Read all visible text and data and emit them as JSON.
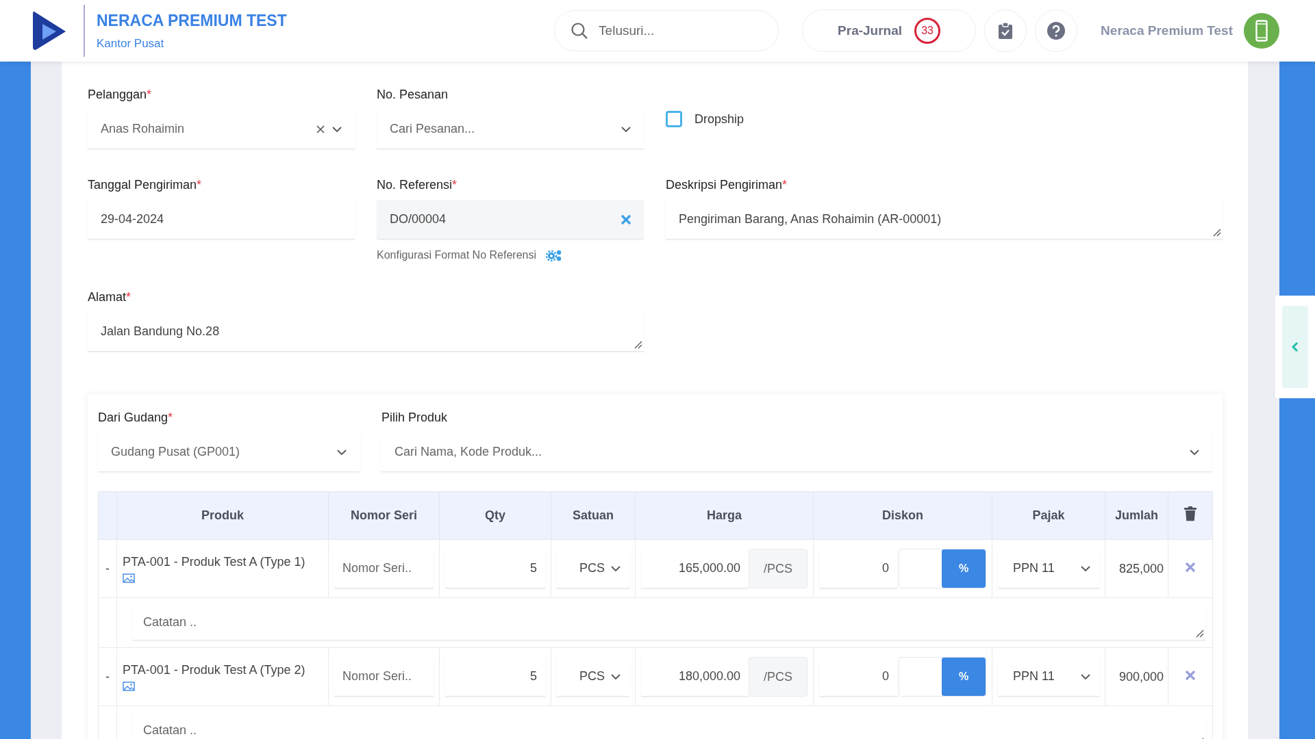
{
  "header": {
    "company": "NERACA PREMIUM TEST",
    "branch": "Kantor Pusat",
    "search_placeholder": "Telusuri...",
    "pre_journal": "Pra-Jurnal",
    "pre_journal_count": "33",
    "user_name": "Neraca Premium Test"
  },
  "form": {
    "customer": {
      "label": "Pelanggan",
      "mark": "*",
      "value": "Anas Rohaimin"
    },
    "order": {
      "label": "No. Pesanan",
      "placeholder": "Cari Pesanan..."
    },
    "dropship": {
      "label": "Dropship",
      "checked": false
    },
    "ship_date": {
      "label": "Tanggal Pengiriman",
      "mark": "*",
      "value": "29-04-2024"
    },
    "reference": {
      "label": "No. Referensi",
      "mark": "*",
      "value": "DO/00004",
      "config_link": "Konfigurasi Format No Referensi"
    },
    "description": {
      "label": "Deskripsi Pengiriman",
      "mark": "*",
      "value": "Pengiriman Barang, Anas Rohaimin (AR-00001)"
    },
    "address": {
      "label": "Alamat",
      "mark": "*",
      "value": "Jalan Bandung No.28"
    }
  },
  "products": {
    "warehouse": {
      "label": "Dari Gudang",
      "mark": "*",
      "value": "Gudang Pusat (GP001)"
    },
    "picker": {
      "label": "Pilih Produk",
      "placeholder": "Cari Nama, Kode Produk..."
    },
    "columns": [
      {
        "kind": "blank"
      },
      {
        "kind": "text",
        "label": "Produk"
      },
      {
        "kind": "text",
        "label": "Nomor Seri"
      },
      {
        "kind": "text",
        "label": "Qty"
      },
      {
        "kind": "text",
        "label": "Satuan"
      },
      {
        "kind": "text",
        "label": "Harga"
      },
      {
        "kind": "text",
        "label": "Diskon"
      },
      {
        "kind": "text",
        "label": "Pajak"
      },
      {
        "kind": "text",
        "label": "Jumlah"
      },
      {
        "kind": "delete"
      }
    ],
    "rows": [
      {
        "toggle": "-",
        "product": "PTA-001 - Produk Test A (Type 1)",
        "serial_placeholder": "Nomor Seri..",
        "qty": "5",
        "unit": "PCS",
        "price": "165,000.00",
        "price_unit": "/PCS",
        "discount": "0",
        "discount_type": "%",
        "tax": "PPN 11",
        "total": "825,000",
        "note_placeholder": "Catatan .."
      },
      {
        "toggle": "-",
        "product": "PTA-001 - Produk Test A (Type 2)",
        "serial_placeholder": "Nomor Seri..",
        "qty": "5",
        "unit": "PCS",
        "price": "180,000.00",
        "price_unit": "/PCS",
        "discount": "0",
        "discount_type": "%",
        "tax": "PPN 11",
        "total": "900,000",
        "note_placeholder": "Catatan .."
      }
    ]
  }
}
